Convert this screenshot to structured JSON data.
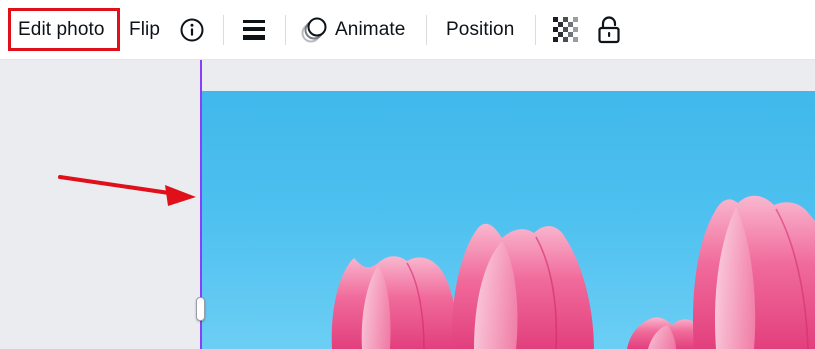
{
  "toolbar": {
    "edit_photo_label": "Edit photo",
    "flip_label": "Flip",
    "info_icon": "info-icon",
    "line_spacing_icon": "lines-icon",
    "animate_label": "Animate",
    "animate_icon": "animate-circles-icon",
    "position_label": "Position",
    "transparency_icon": "checkerboard-icon",
    "lock_icon": "unlocked-padlock-icon"
  },
  "annotation": {
    "highlight_color": "#e0101a",
    "arrow_color": "#e0101a"
  },
  "canvas": {
    "guide_color": "#8b3dff",
    "sky_color": "#41b8eb",
    "tulip_color": "#f06a9a"
  }
}
